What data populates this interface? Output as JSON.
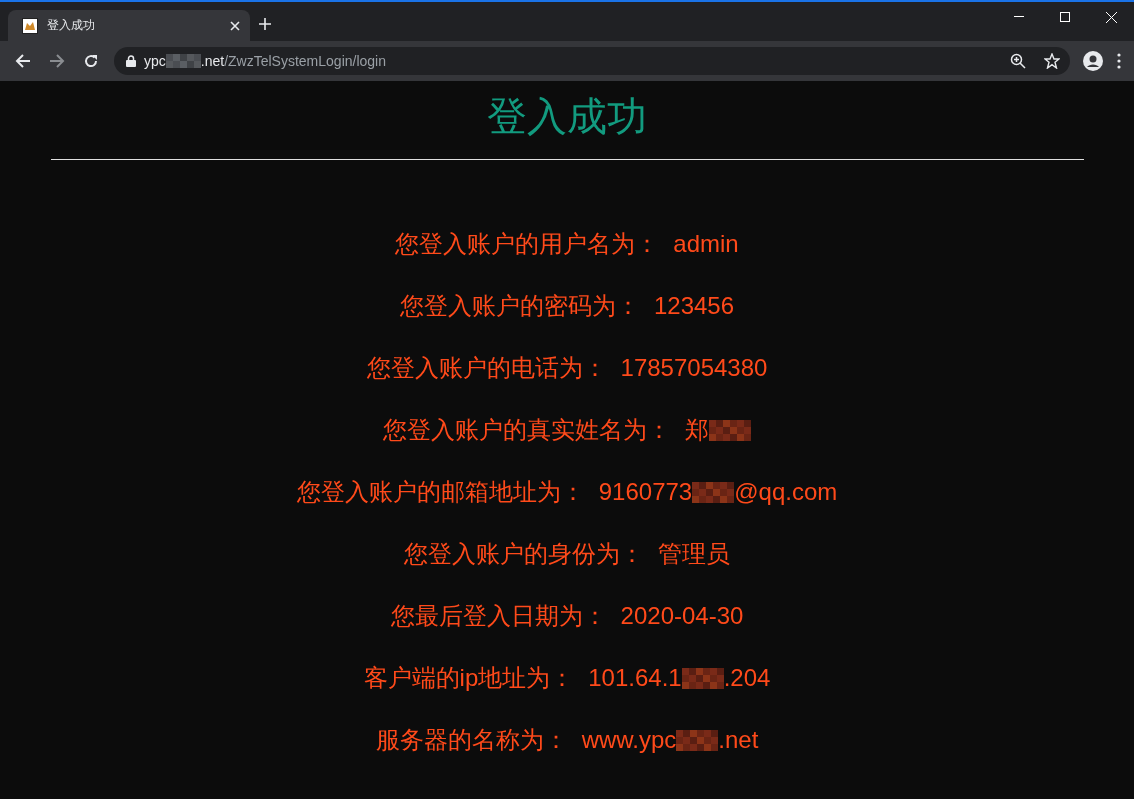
{
  "browser": {
    "tab": {
      "title": "登入成功",
      "selected": true
    },
    "address": {
      "parts": [
        {
          "kind": "host",
          "text": "ypc"
        },
        {
          "kind": "redacted"
        },
        {
          "kind": "host",
          "text": ".net"
        },
        {
          "kind": "path",
          "text": "/ZwzTelSystemLogin/login"
        }
      ]
    }
  },
  "page": {
    "title": "登入成功",
    "rows": [
      {
        "label": "您登入账户的用户名为：",
        "value": [
          {
            "kind": "text",
            "text": "admin"
          }
        ]
      },
      {
        "label": "您登入账户的密码为：",
        "value": [
          {
            "kind": "text",
            "text": "123456"
          }
        ]
      },
      {
        "label": "您登入账户的电话为：",
        "value": [
          {
            "kind": "text",
            "text": "17857054380"
          }
        ]
      },
      {
        "label": "您登入账户的真实姓名为：",
        "value": [
          {
            "kind": "text",
            "text": "郑"
          },
          {
            "kind": "redacted"
          }
        ]
      },
      {
        "label": "您登入账户的邮箱地址为：",
        "value": [
          {
            "kind": "text",
            "text": "9160773"
          },
          {
            "kind": "redacted"
          },
          {
            "kind": "text",
            "text": "@qq.com"
          }
        ]
      },
      {
        "label": "您登入账户的身份为：",
        "value": [
          {
            "kind": "text",
            "text": "管理员"
          }
        ]
      },
      {
        "label": "您最后登入日期为：",
        "value": [
          {
            "kind": "text",
            "text": "2020-04-30"
          }
        ]
      },
      {
        "label": "客户端的ip地址为：",
        "value": [
          {
            "kind": "text",
            "text": "101.64.1"
          },
          {
            "kind": "redacted"
          },
          {
            "kind": "text",
            "text": ".204"
          }
        ]
      },
      {
        "label": "服务器的名称为：",
        "value": [
          {
            "kind": "text",
            "text": "www.ypc"
          },
          {
            "kind": "redacted"
          },
          {
            "kind": "text",
            "text": ".net"
          }
        ]
      }
    ]
  }
}
